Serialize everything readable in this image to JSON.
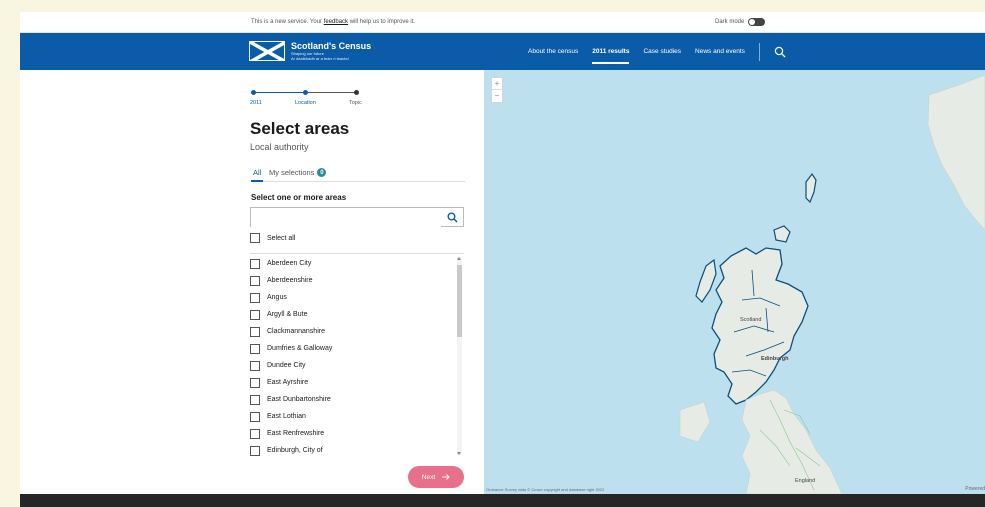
{
  "banner": {
    "message_prefix": "This is a new service. Your ",
    "feedback_link": "feedback",
    "message_suffix": " will help us to improve it.",
    "dark_mode_label": "Dark mode"
  },
  "header": {
    "logo_title": "Scotland's Census",
    "logo_tagline_1": "Shaping our future",
    "logo_tagline_2": "Ar dealbhadh ar a teàrr ri teachd",
    "nav": [
      "About the census",
      "2011 results",
      "Case studies",
      "News and events"
    ],
    "active_nav": "2011 results"
  },
  "stepper": {
    "steps": [
      "2011",
      "Location",
      "Topic"
    ]
  },
  "page": {
    "title": "Select areas",
    "subtitle": "Local authority",
    "tab_all": "All",
    "tab_selections": "My selections",
    "selection_count": "0",
    "select_label": "Select one or more areas",
    "search_placeholder": "",
    "select_all": "Select all",
    "areas": [
      "Aberdeen City",
      "Aberdeenshire",
      "Angus",
      "Argyll & Bute",
      "Clackmannanshire",
      "Dumfries & Galloway",
      "Dundee City",
      "East Ayrshire",
      "East Dunbartonshire",
      "East Lothian",
      "East Renfrewshire",
      "Edinburgh, City of"
    ],
    "next_label": "Next"
  },
  "map": {
    "zoom_in": "+",
    "zoom_out": "−",
    "labels": {
      "scotland": "Scotland",
      "edinburgh": "Edinburgh",
      "england": "England"
    },
    "attribution": "Ordnance Survey data © Crown copyright and database right 2022",
    "powered": "Powered"
  },
  "colors": {
    "brand_blue": "#0a5ca8",
    "next_button": "#e8708a",
    "map_water": "#bde0ef",
    "map_land": "#e6ebe5",
    "boundary": "#0b4f7a"
  }
}
